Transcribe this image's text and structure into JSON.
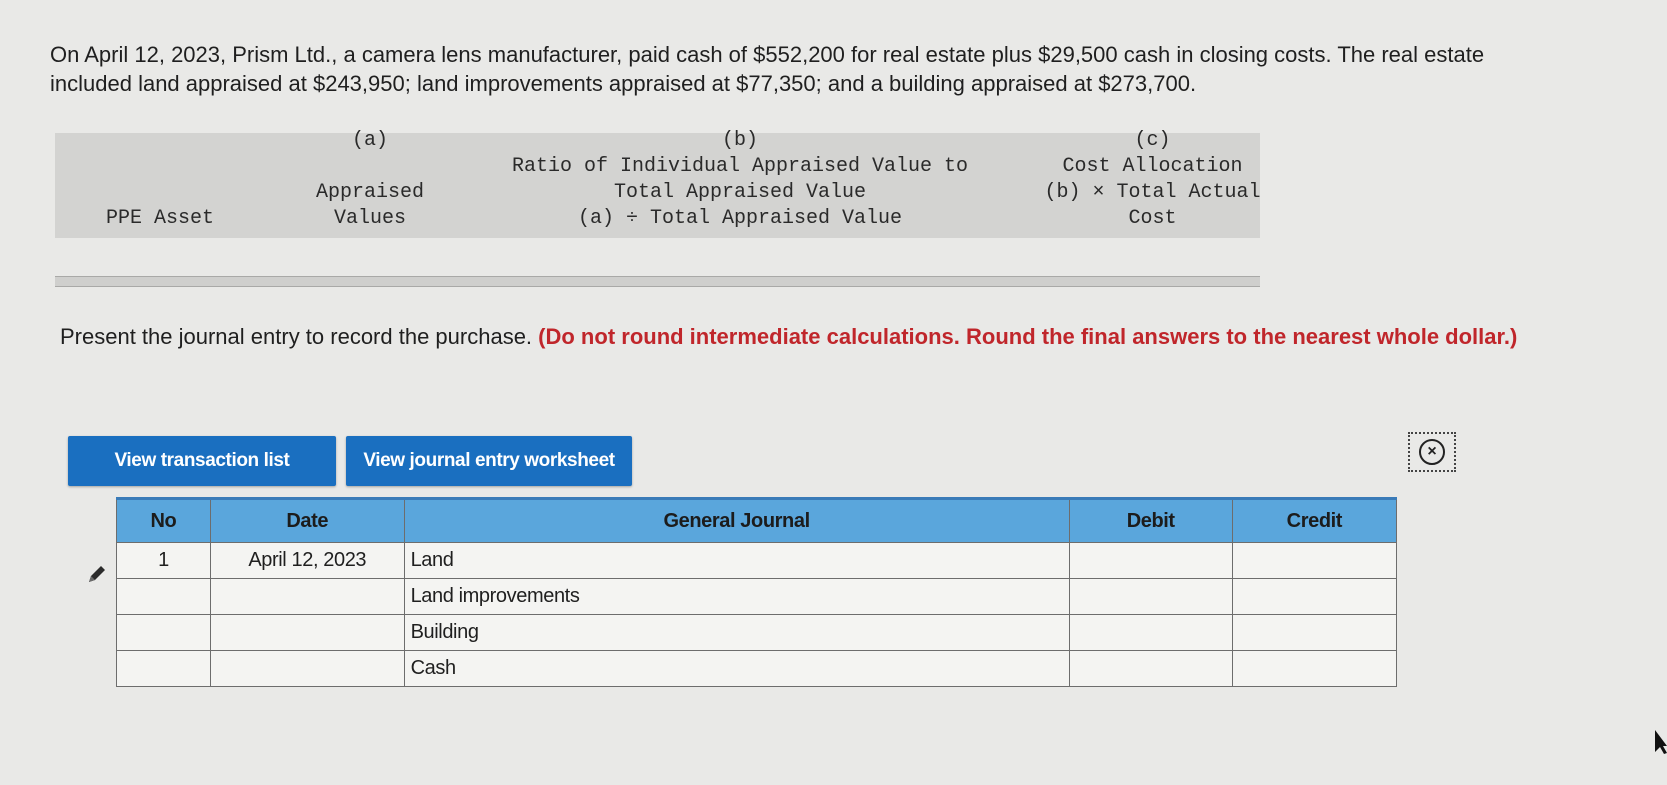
{
  "problem": {
    "text": "On April 12, 2023, Prism Ltd., a camera lens manufacturer, paid cash of $552,200 for real estate plus $29,500 cash in closing costs. The real estate included land appraised at $243,950; land improvements appraised at $77,350; and a building appraised at $273,700."
  },
  "allocation_table": {
    "col_asset": [
      "PPE Asset"
    ],
    "col_a": [
      "(a)",
      "",
      "Appraised",
      "Values"
    ],
    "col_b": [
      "(b)",
      "Ratio of Individual Appraised Value to",
      "Total Appraised Value",
      "(a) ÷ Total Appraised Value"
    ],
    "col_c": [
      "(c)",
      "Cost Allocation",
      "(b) × Total Actual",
      "Cost"
    ]
  },
  "instruction": {
    "main": "Present the journal entry to record the purchase.",
    "note": "(Do not round intermediate calculations. Round the final answers to the nearest whole dollar.)"
  },
  "buttons": {
    "transaction_list": "View transaction list",
    "journal_worksheet": "View journal entry worksheet"
  },
  "close_symbol": "×",
  "journal": {
    "headers": {
      "no": "No",
      "date": "Date",
      "account": "General Journal",
      "debit": "Debit",
      "credit": "Credit"
    },
    "rows": [
      {
        "no": "1",
        "date": "April 12, 2023",
        "account": "Land",
        "debit": "",
        "credit": ""
      },
      {
        "no": "",
        "date": "",
        "account": "Land improvements",
        "debit": "",
        "credit": ""
      },
      {
        "no": "",
        "date": "",
        "account": "Building",
        "debit": "",
        "credit": ""
      },
      {
        "no": "",
        "date": "",
        "account": "Cash",
        "debit": "",
        "credit": ""
      }
    ]
  },
  "icons": {
    "edit": "pencil-icon",
    "close": "close-circle-icon",
    "cursor": "mouse-cursor-icon"
  },
  "colors": {
    "button": "#1a6fc0",
    "table_header": "#5aa6dc",
    "emphasis_red": "#c0262b"
  }
}
